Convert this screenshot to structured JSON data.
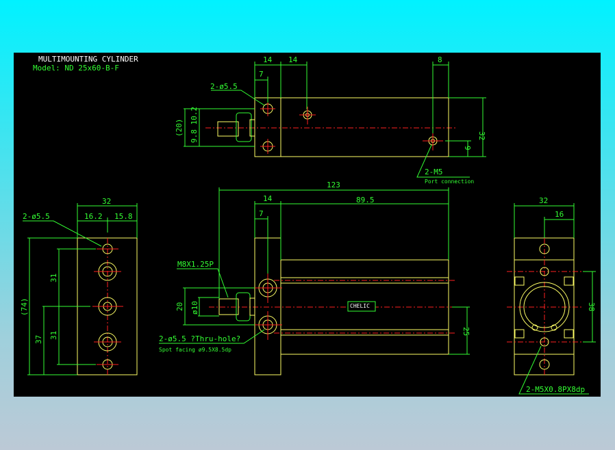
{
  "title": "MULTIMOUNTING CYLINDER",
  "model": "Model: ND 25x60-B-F",
  "colors": {
    "background_top": "#00f2ff",
    "background_bottom": "#bcc9d6",
    "canvas": "#000000",
    "outline": "#ffff66",
    "dimension": "#33ff33",
    "centerline": "#ff2020"
  },
  "top_view": {
    "dims": {
      "flange": "14",
      "port_offset": "14",
      "hole_offset": "7",
      "rear_port": "8",
      "height": "32",
      "port_height": "9",
      "rod_height": "(20)",
      "rod_split": "9.8 10.2"
    },
    "hole_note": "2-ø5.5",
    "port_note": "2-M5",
    "port_note_sub": "Port connection"
  },
  "front_view": {
    "dims": {
      "overall": "123",
      "flange": "14",
      "body": "89.5",
      "hole_offset": "7",
      "rod_height": "20",
      "rod_dia": "ø10",
      "bottom": "25"
    },
    "thread_note": "M8X1.25P",
    "hole_note": "2-ø5.5 ?Thru-hole?",
    "hole_note_sub": "Spot facing  ø9.5X8.5dp",
    "logo": "CHELIC"
  },
  "left_view": {
    "dims": {
      "width": "32",
      "left": "16.2",
      "right": "15.8",
      "overall": "(74)",
      "pitch_top": "31",
      "pitch_bottom": "31",
      "bottom": "37"
    },
    "hole_note": "2-ø5.5"
  },
  "right_view": {
    "dims": {
      "width": "32",
      "half": "16",
      "pitch": "38"
    },
    "hole_note": "2-M5X0.8PX8dp"
  }
}
